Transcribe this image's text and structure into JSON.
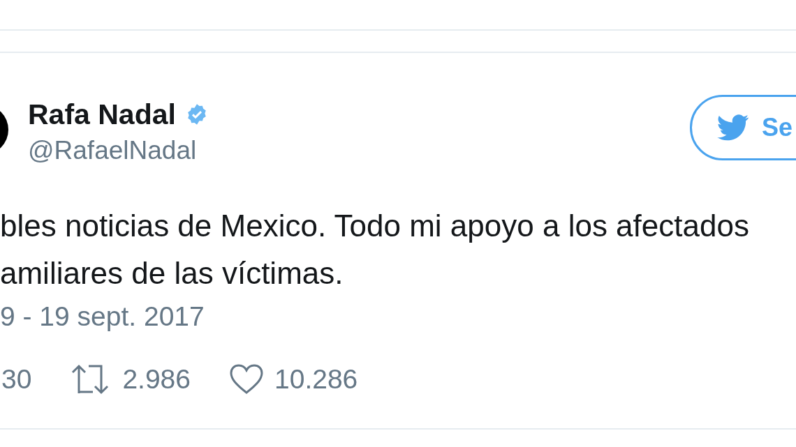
{
  "tweet": {
    "author_name": "Rafa Nadal",
    "verified": true,
    "handle": "@RafaelNadal",
    "follow_button": {
      "label": "Se"
    },
    "text_lines": [
      "bles noticias de Mexico. Todo mi apoyo a los afectados",
      "amiliares de las víctimas."
    ],
    "timestamp": "9 - 19 sept. 2017",
    "actions": [
      {
        "kind": "reply",
        "count": "30"
      },
      {
        "kind": "retweet",
        "count": "2.986"
      },
      {
        "kind": "like",
        "count": "10.286"
      }
    ]
  }
}
